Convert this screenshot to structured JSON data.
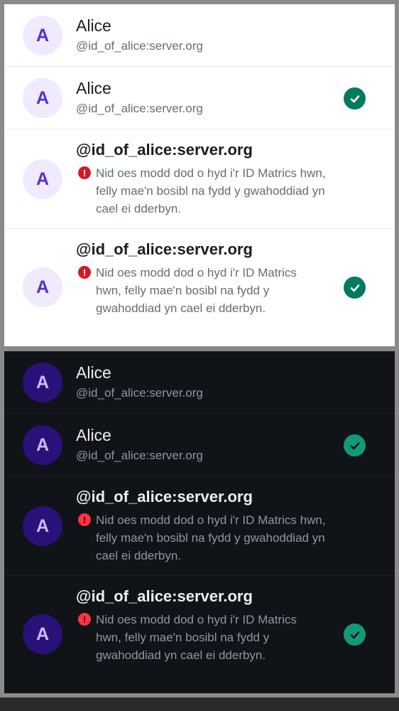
{
  "colors": {
    "light_accent": "#007a61",
    "dark_accent": "#129a78",
    "light_avatar_bg": "#efeafd",
    "light_avatar_text": "#5a2fd0",
    "dark_avatar_bg": "#2a117a",
    "dark_avatar_text": "#c9b9ff",
    "light_warning": "#d51928",
    "dark_warning": "#fe3442"
  },
  "light": {
    "rows": [
      {
        "avatar_letter": "A",
        "name": "Alice",
        "user_id": "@id_of_alice:server.org",
        "selected": false
      },
      {
        "avatar_letter": "A",
        "name": "Alice",
        "user_id": "@id_of_alice:server.org",
        "selected": true,
        "check_icon": "check-circle-icon"
      },
      {
        "avatar_letter": "A",
        "name": "@id_of_alice:server.org",
        "warning_icon": "error-icon",
        "warning": "Nid oes modd dod o hyd i'r ID Matrics hwn, felly mae'n bosibl na fydd y gwahoddiad yn cael ei dderbyn.",
        "selected": false
      },
      {
        "avatar_letter": "A",
        "name": "@id_of_alice:server.org",
        "warning_icon": "error-icon",
        "warning": "Nid oes modd dod o hyd i'r ID Matrics hwn, felly mae'n bosibl na fydd y gwahoddiad yn cael ei dderbyn.",
        "selected": true,
        "check_icon": "check-circle-icon"
      }
    ]
  },
  "dark": {
    "rows": [
      {
        "avatar_letter": "A",
        "name": "Alice",
        "user_id": "@id_of_alice:server.org",
        "selected": false
      },
      {
        "avatar_letter": "A",
        "name": "Alice",
        "user_id": "@id_of_alice:server.org",
        "selected": true,
        "check_icon": "check-circle-icon"
      },
      {
        "avatar_letter": "A",
        "name": "@id_of_alice:server.org",
        "warning_icon": "error-icon",
        "warning": "Nid oes modd dod o hyd i'r ID Matrics hwn, felly mae'n bosibl na fydd y gwahoddiad yn cael ei dderbyn.",
        "selected": false
      },
      {
        "avatar_letter": "A",
        "name": "@id_of_alice:server.org",
        "warning_icon": "error-icon",
        "warning": "Nid oes modd dod o hyd i'r ID Matrics hwn, felly mae'n bosibl na fydd y gwahoddiad yn cael ei dderbyn.",
        "selected": true,
        "check_icon": "check-circle-icon"
      }
    ]
  }
}
